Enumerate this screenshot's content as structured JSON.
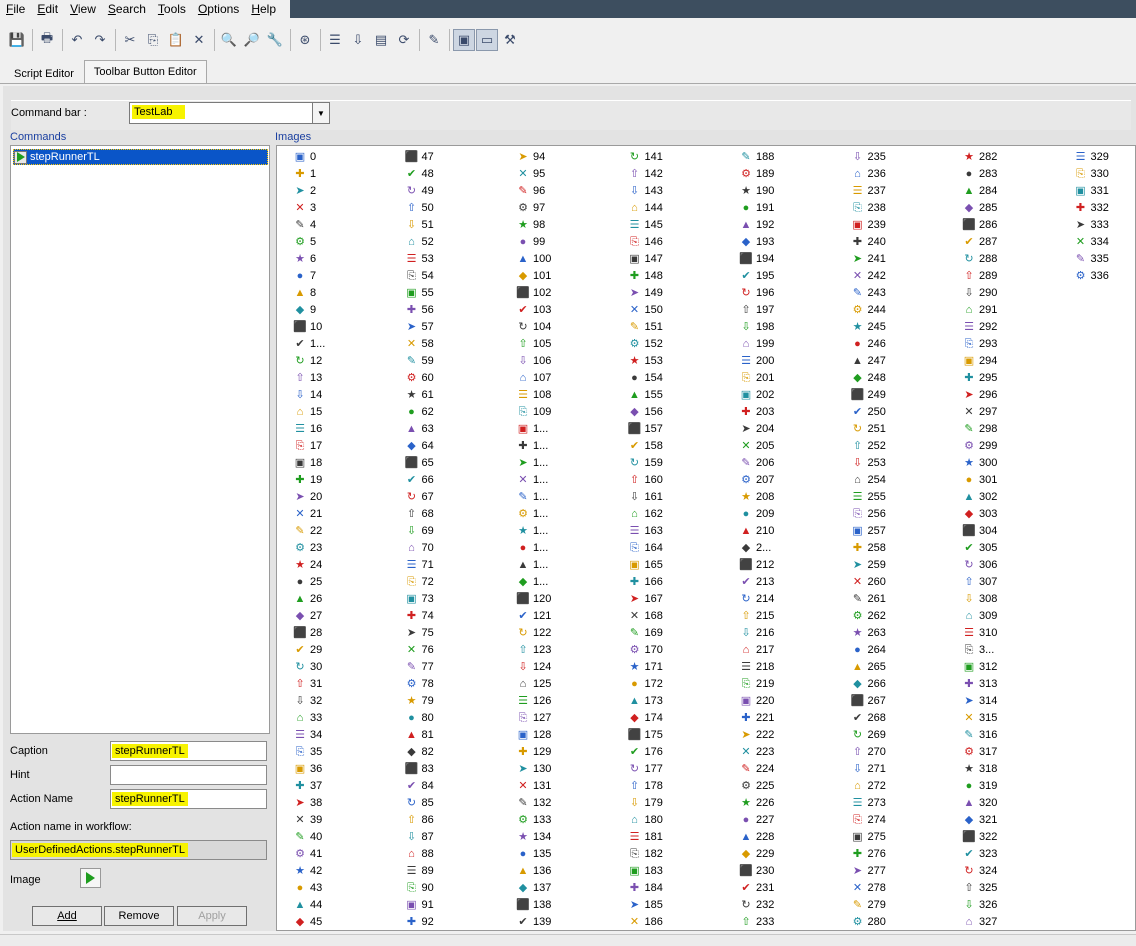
{
  "menu": [
    "File",
    "Edit",
    "View",
    "Search",
    "Tools",
    "Options",
    "Help"
  ],
  "toolbar": [
    {
      "icon": "save-icon",
      "glyph": "💾",
      "sep_after": true
    },
    {
      "icon": "print-icon",
      "glyph": "🖶",
      "sep_after": true
    },
    {
      "icon": "undo-icon",
      "glyph": "↶"
    },
    {
      "icon": "redo-icon",
      "glyph": "↷",
      "sep_after": true
    },
    {
      "icon": "cut-icon",
      "glyph": "✂"
    },
    {
      "icon": "copy-icon",
      "glyph": "⎘"
    },
    {
      "icon": "paste-icon",
      "glyph": "📋"
    },
    {
      "icon": "delete-icon",
      "glyph": "✕",
      "sep_after": true
    },
    {
      "icon": "find-icon",
      "glyph": "🔍"
    },
    {
      "icon": "find-next-icon",
      "glyph": "🔎"
    },
    {
      "icon": "replace-icon",
      "glyph": "🔧",
      "sep_after": true
    },
    {
      "icon": "run-icon",
      "glyph": "⊛",
      "sep_after": true
    },
    {
      "icon": "list-icon",
      "glyph": "☰"
    },
    {
      "icon": "download-icon",
      "glyph": "⇩"
    },
    {
      "icon": "document-icon",
      "glyph": "▤"
    },
    {
      "icon": "refresh-icon",
      "glyph": "⟳",
      "sep_after": true
    },
    {
      "icon": "check-syntax-icon",
      "glyph": "✎",
      "sep_after": true
    },
    {
      "icon": "script-view-icon",
      "glyph": "▣",
      "pressed": true
    },
    {
      "icon": "button-view-icon",
      "glyph": "▭",
      "pressed": true
    },
    {
      "icon": "tools-icon",
      "glyph": "⚒"
    }
  ],
  "tabs": [
    {
      "label": "Script Editor",
      "active": false
    },
    {
      "label": "Toolbar Button Editor",
      "active": true
    }
  ],
  "command_bar": {
    "label": "Command bar :",
    "value": "TestLab"
  },
  "commands": {
    "title": "Commands",
    "items": [
      "stepRunnerTL"
    ]
  },
  "images_title": "Images",
  "form": {
    "caption_label": "Caption",
    "caption_value": "stepRunnerTL",
    "hint_label": "Hint",
    "hint_value": "",
    "action_label": "Action Name",
    "action_value": "stepRunnerTL",
    "workflow_label": "Action name in workflow:",
    "workflow_value": "UserDefinedActions.stepRunnerTL",
    "image_label": "Image"
  },
  "buttons": {
    "add": "Add",
    "remove": "Remove",
    "apply": "Apply"
  },
  "image_columns": [
    [
      "0",
      "1",
      "2",
      "3",
      "4",
      "5",
      "6",
      "7",
      "8",
      "9",
      "10",
      "1...",
      "12",
      "13",
      "14",
      "15",
      "16",
      "17",
      "18",
      "19",
      "20",
      "21",
      "22",
      "23",
      "24",
      "25",
      "26",
      "27",
      "28",
      "29",
      "30",
      "31",
      "32",
      "33",
      "34",
      "35",
      "36",
      "37",
      "38",
      "39",
      "40",
      "41",
      "42",
      "43",
      "44",
      "45"
    ],
    [
      "47",
      "48",
      "49",
      "50",
      "51",
      "52",
      "53",
      "54",
      "55",
      "56",
      "57",
      "58",
      "59",
      "60",
      "61",
      "62",
      "63",
      "64",
      "65",
      "66",
      "67",
      "68",
      "69",
      "70",
      "71",
      "72",
      "73",
      "74",
      "75",
      "76",
      "77",
      "78",
      "79",
      "80",
      "81",
      "82",
      "83",
      "84",
      "85",
      "86",
      "87",
      "88",
      "89",
      "90",
      "91",
      "92"
    ],
    [
      "94",
      "95",
      "96",
      "97",
      "98",
      "99",
      "100",
      "101",
      "102",
      "103",
      "104",
      "105",
      "106",
      "107",
      "108",
      "109",
      "1...",
      "1...",
      "1...",
      "1...",
      "1...",
      "1...",
      "1...",
      "1...",
      "1...",
      "1...",
      "120",
      "121",
      "122",
      "123",
      "124",
      "125",
      "126",
      "127",
      "128",
      "129",
      "130",
      "131",
      "132",
      "133",
      "134",
      "135",
      "136",
      "137",
      "138",
      "139"
    ],
    [
      "141",
      "142",
      "143",
      "144",
      "145",
      "146",
      "147",
      "148",
      "149",
      "150",
      "151",
      "152",
      "153",
      "154",
      "155",
      "156",
      "157",
      "158",
      "159",
      "160",
      "161",
      "162",
      "163",
      "164",
      "165",
      "166",
      "167",
      "168",
      "169",
      "170",
      "171",
      "172",
      "173",
      "174",
      "175",
      "176",
      "177",
      "178",
      "179",
      "180",
      "181",
      "182",
      "183",
      "184",
      "185",
      "186"
    ],
    [
      "188",
      "189",
      "190",
      "191",
      "192",
      "193",
      "194",
      "195",
      "196",
      "197",
      "198",
      "199",
      "200",
      "201",
      "202",
      "203",
      "204",
      "205",
      "206",
      "207",
      "208",
      "209",
      "210",
      "2...",
      "212",
      "213",
      "214",
      "215",
      "216",
      "217",
      "218",
      "219",
      "220",
      "221",
      "222",
      "223",
      "224",
      "225",
      "226",
      "227",
      "228",
      "229",
      "230",
      "231",
      "232",
      "233"
    ],
    [
      "235",
      "236",
      "237",
      "238",
      "239",
      "240",
      "241",
      "242",
      "243",
      "244",
      "245",
      "246",
      "247",
      "248",
      "249",
      "250",
      "251",
      "252",
      "253",
      "254",
      "255",
      "256",
      "257",
      "258",
      "259",
      "260",
      "261",
      "262",
      "263",
      "264",
      "265",
      "266",
      "267",
      "268",
      "269",
      "270",
      "271",
      "272",
      "273",
      "274",
      "275",
      "276",
      "277",
      "278",
      "279",
      "280"
    ],
    [
      "282",
      "283",
      "284",
      "285",
      "286",
      "287",
      "288",
      "289",
      "290",
      "291",
      "292",
      "293",
      "294",
      "295",
      "296",
      "297",
      "298",
      "299",
      "300",
      "301",
      "302",
      "303",
      "304",
      "305",
      "306",
      "307",
      "308",
      "309",
      "310",
      "3...",
      "312",
      "313",
      "314",
      "315",
      "316",
      "317",
      "318",
      "319",
      "320",
      "321",
      "322",
      "323",
      "324",
      "325",
      "326",
      "327"
    ],
    [
      "329",
      "330",
      "331",
      "332",
      "333",
      "334",
      "335",
      "336"
    ]
  ]
}
